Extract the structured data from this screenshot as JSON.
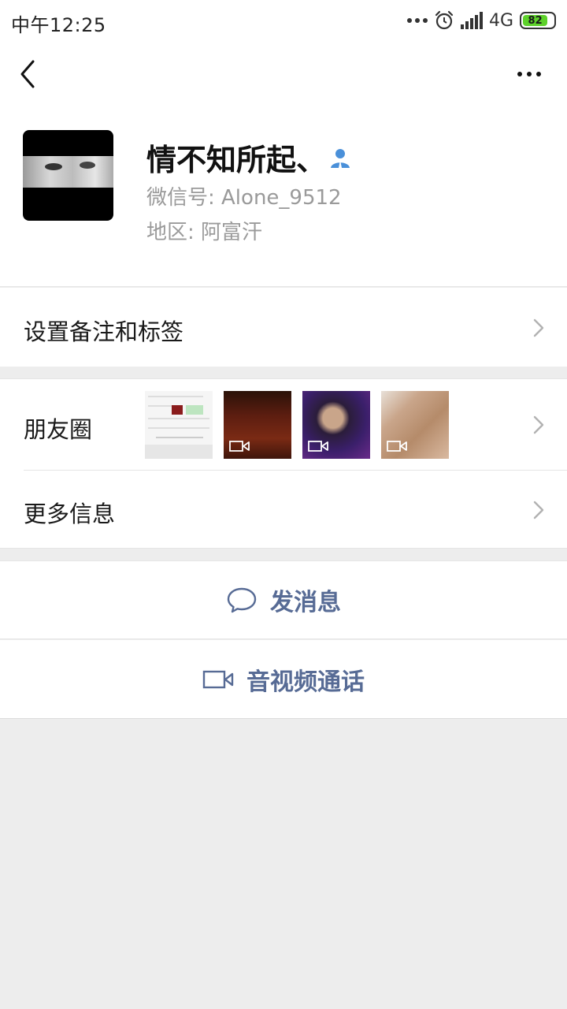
{
  "status_bar": {
    "time": "中午12:25",
    "network": "4G",
    "battery": "82",
    "battery_level": 0.82,
    "icons": [
      "more-dots-icon",
      "alarm-icon",
      "signal-icon",
      "battery-icon"
    ]
  },
  "nav": {
    "back_icon": "back-arrow-icon",
    "more_icon": "more-dots-icon"
  },
  "profile": {
    "name": "情不知所起、",
    "wechat_id": "微信号: Alone_9512",
    "region": "地区: 阿富汗",
    "contact_icon": "contact-person-icon",
    "contact_icon_color": "#4a90d9"
  },
  "rows": {
    "remark": "设置备注和标签",
    "moments": "朋友圈",
    "more_info": "更多信息"
  },
  "moments_thumbs": [
    {
      "type": "image"
    },
    {
      "type": "video"
    },
    {
      "type": "video"
    },
    {
      "type": "video"
    }
  ],
  "actions": {
    "message": "发消息",
    "message_icon": "chat-bubble-icon",
    "call": "音视频通话",
    "call_icon": "video-camera-icon",
    "accent_color": "#576b95"
  }
}
